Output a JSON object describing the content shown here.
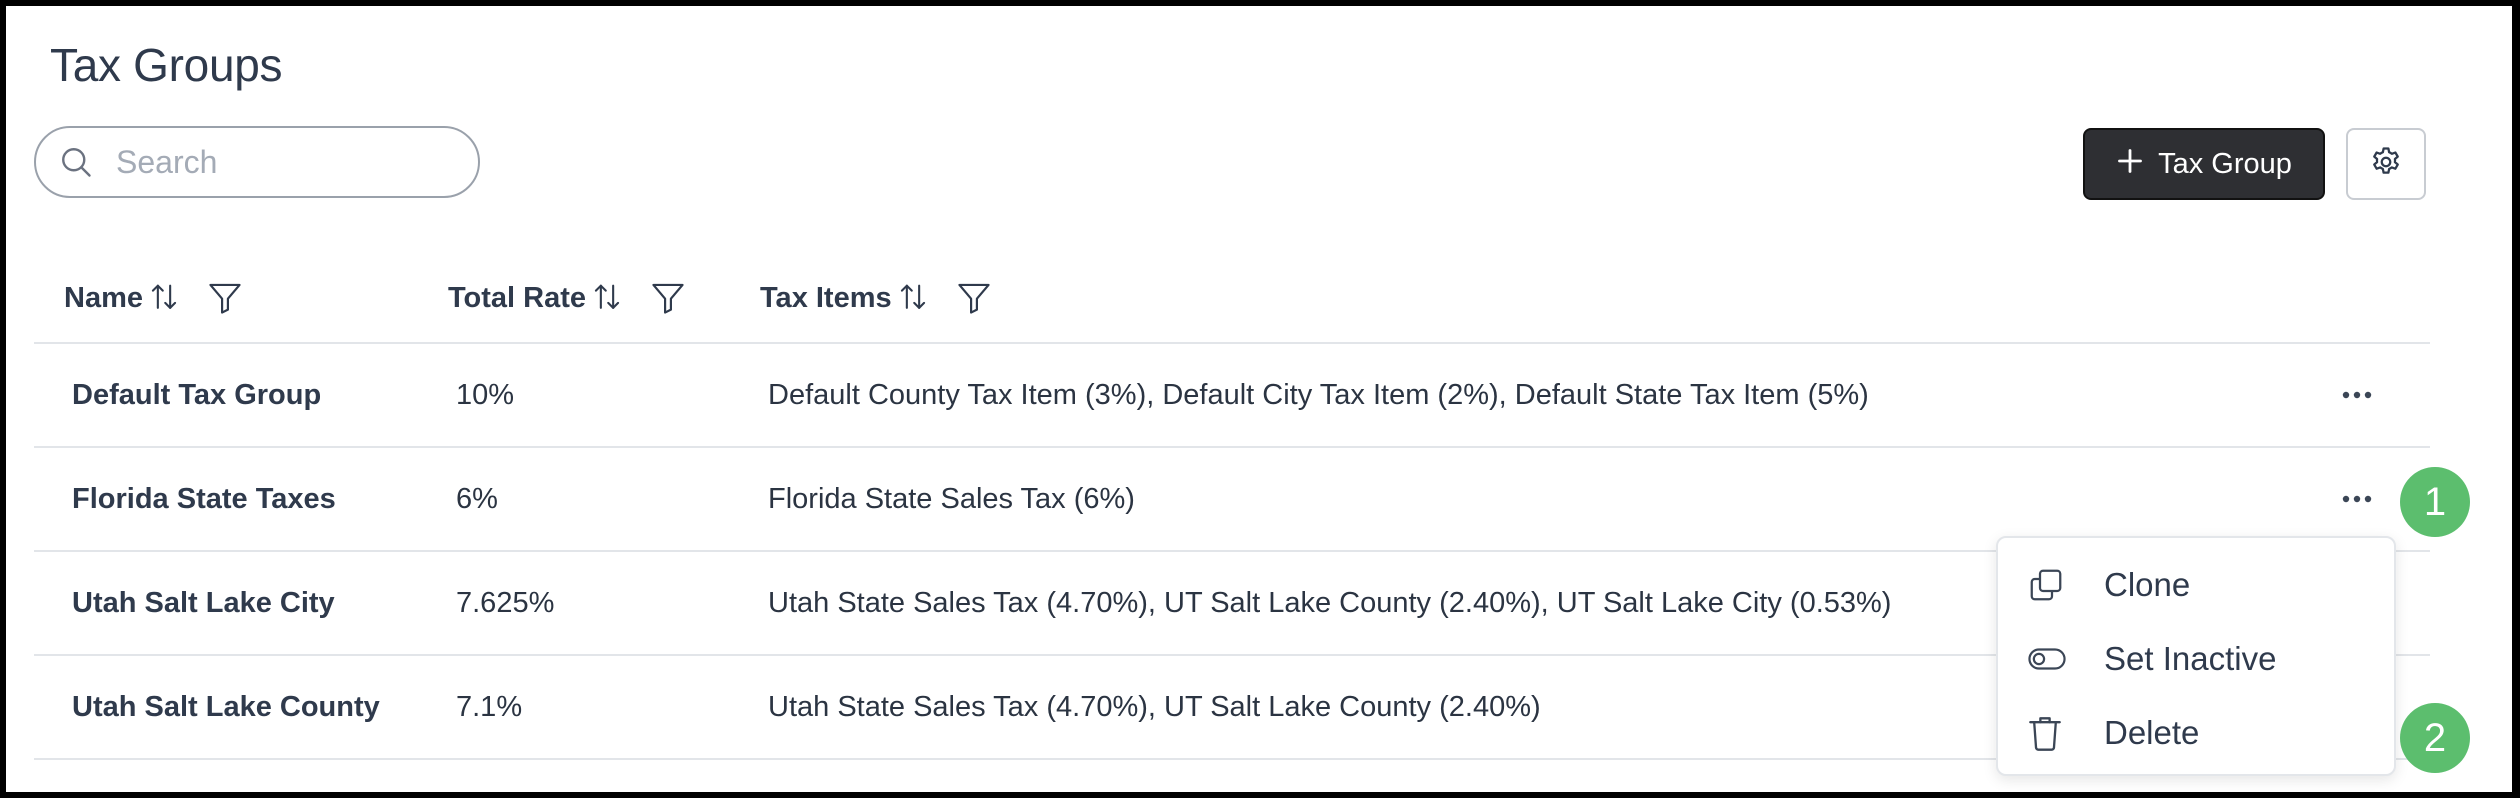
{
  "page": {
    "title": "Tax Groups"
  },
  "search": {
    "placeholder": "Search"
  },
  "toolbar": {
    "add_label": "Tax Group"
  },
  "table": {
    "columns": [
      "Name",
      "Total Rate",
      "Tax Items"
    ],
    "rows": [
      {
        "name": "Default Tax Group",
        "rate": "10%",
        "items": "Default County Tax Item (3%), Default City Tax Item (2%), Default State Tax Item (5%)"
      },
      {
        "name": "Florida State Taxes",
        "rate": "6%",
        "items": "Florida State Sales Tax (6%)"
      },
      {
        "name": "Utah Salt Lake City",
        "rate": "7.625%",
        "items": "Utah State Sales Tax (4.70%), UT Salt Lake County (2.40%), UT Salt Lake City (0.53%)"
      },
      {
        "name": "Utah Salt Lake County",
        "rate": "7.1%",
        "items": "Utah State Sales Tax (4.70%), UT Salt Lake County (2.40%)"
      }
    ]
  },
  "context_menu": {
    "items": [
      {
        "label": "Clone",
        "icon": "clone-icon"
      },
      {
        "label": "Set Inactive",
        "icon": "toggle-icon"
      },
      {
        "label": "Delete",
        "icon": "trash-icon"
      }
    ]
  },
  "callouts": [
    "1",
    "2"
  ],
  "colors": {
    "primary_button": "#2e2f33",
    "callout": "#5cbe6e",
    "divider": "#e2e5e9",
    "text": "#2f3a4c"
  }
}
